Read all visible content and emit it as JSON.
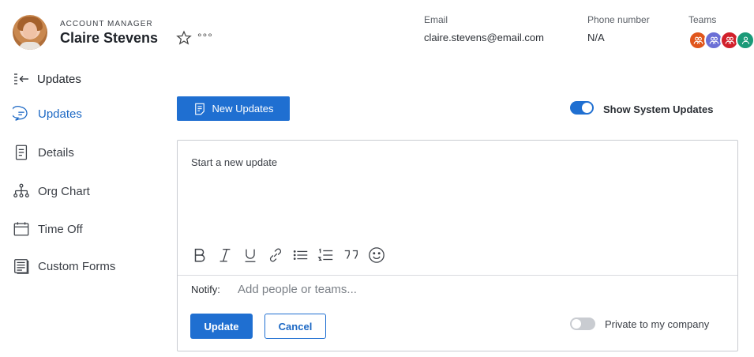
{
  "profile": {
    "role": "ACCOUNT MANAGER",
    "name": "Claire Stevens",
    "more_label": "°°°"
  },
  "contact": {
    "email_label": "Email",
    "email_value": "claire.stevens@email.com",
    "phone_label": "Phone number",
    "phone_value": "N/A",
    "teams_label": "Teams",
    "team_colors": [
      "#e0561c",
      "#6b6fd6",
      "#d1202b",
      "#1b9a78"
    ]
  },
  "sidebar": {
    "collapse_label": "Updates",
    "items": [
      {
        "label": "Updates",
        "icon": "chat-bubble-icon",
        "active": true
      },
      {
        "label": "Details",
        "icon": "document-icon",
        "active": false
      },
      {
        "label": "Org Chart",
        "icon": "org-chart-icon",
        "active": false
      },
      {
        "label": "Time Off",
        "icon": "calendar-icon",
        "active": false
      },
      {
        "label": "Custom Forms",
        "icon": "forms-icon",
        "active": false
      }
    ]
  },
  "actions": {
    "new_updates_label": "New Updates",
    "show_system_updates_label": "Show System Updates",
    "show_system_updates_on": true
  },
  "editor": {
    "placeholder": "Start a new update",
    "toolbar": [
      "bold-icon",
      "italic-icon",
      "underline-icon",
      "link-icon",
      "bullet-list-icon",
      "numbered-list-icon",
      "quote-icon",
      "emoji-icon"
    ],
    "notify_label": "Notify:",
    "notify_placeholder": "Add people or teams...",
    "update_label": "Update",
    "cancel_label": "Cancel",
    "private_label": "Private to my company",
    "private_on": false
  },
  "colors": {
    "accent": "#1f6fd1",
    "active_nav": "#1c68c4"
  }
}
